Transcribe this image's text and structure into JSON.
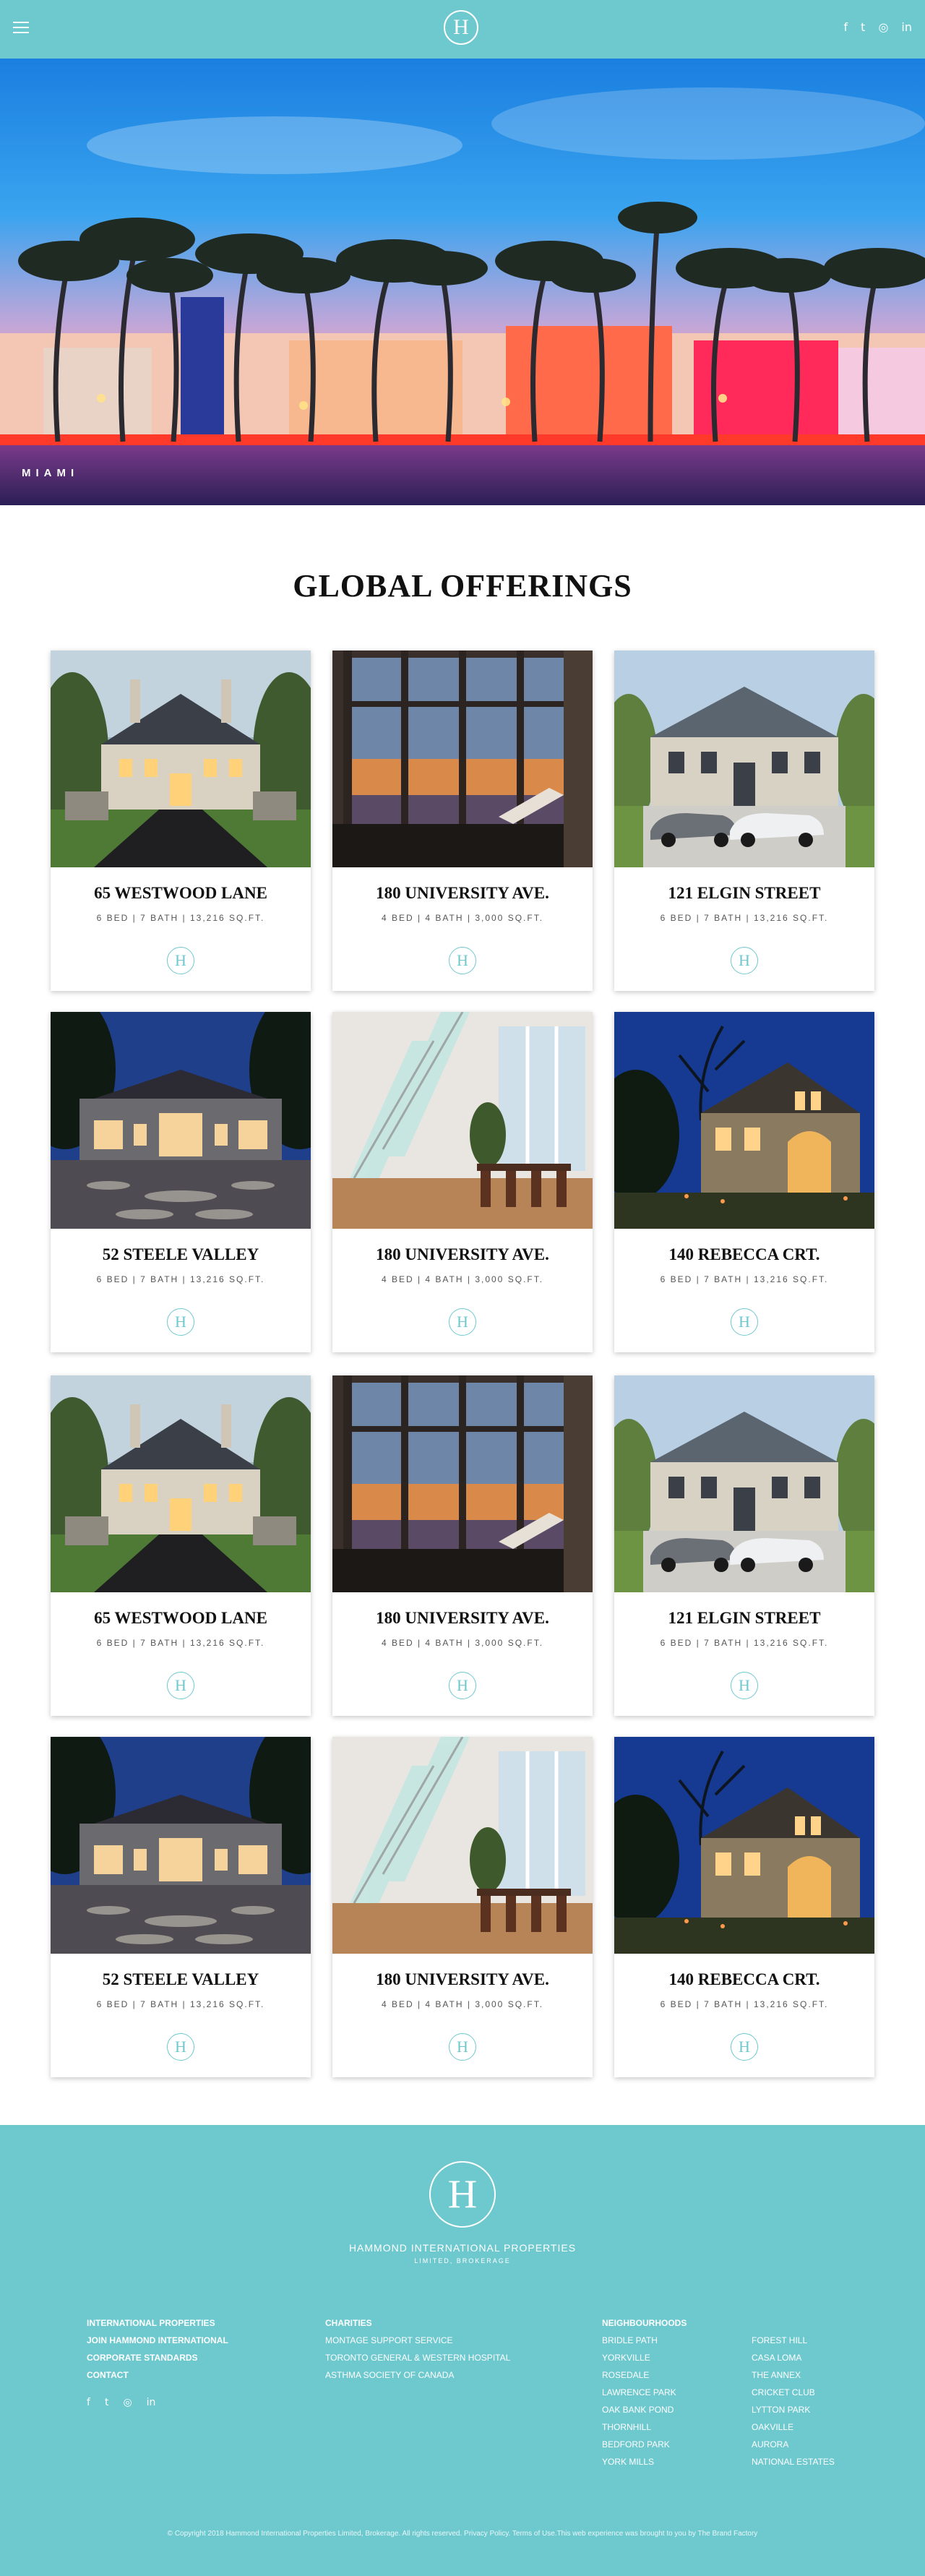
{
  "header": {
    "menu_icon": "hamburger-icon",
    "logo_letter": "H",
    "social": [
      {
        "icon": "facebook-icon",
        "glyph": "f"
      },
      {
        "icon": "twitter-icon",
        "glyph": "t"
      },
      {
        "icon": "instagram-icon",
        "glyph": "◎"
      },
      {
        "icon": "linkedin-icon",
        "glyph": "in"
      }
    ]
  },
  "hero": {
    "label": "MIAMI"
  },
  "section": {
    "title": "GLOBAL OFFERINGS"
  },
  "listings": [
    {
      "name": "65 WESTWOOD LANE",
      "specs": "6 BED  |  7 BATH  |  13,216 SQ.FT.",
      "logo": "H",
      "scene": "mansion-dusk"
    },
    {
      "name": "180 UNIVERSITY AVE.",
      "specs": "4 BED  |  4 BATH  |  3,000 SQ.FT.",
      "logo": "H",
      "scene": "penthouse-window"
    },
    {
      "name": "121 ELGIN STREET",
      "specs": "6 BED  |  7 BATH  |  13,216 SQ.FT.",
      "logo": "H",
      "scene": "estate-cars"
    },
    {
      "name": "52 STEELE VALLEY",
      "specs": "6 BED  |  7 BATH  |  13,216 SQ.FT.",
      "logo": "H",
      "scene": "night-courtyard"
    },
    {
      "name": "180 UNIVERSITY AVE.",
      "specs": "4 BED  |  4 BATH  |  3,000 SQ.FT.",
      "logo": "H",
      "scene": "glass-staircase"
    },
    {
      "name": "140 REBECCA CRT.",
      "specs": "6 BED  |  7 BATH  |  13,216 SQ.FT.",
      "logo": "H",
      "scene": "stone-house-night"
    },
    {
      "name": "65 WESTWOOD LANE",
      "specs": "6 BED  |  7 BATH  |  13,216 SQ.FT.",
      "logo": "H",
      "scene": "mansion-dusk"
    },
    {
      "name": "180 UNIVERSITY AVE.",
      "specs": "4 BED  |  4 BATH  |  3,000 SQ.FT.",
      "logo": "H",
      "scene": "penthouse-window"
    },
    {
      "name": "121 ELGIN STREET",
      "specs": "6 BED  |  7 BATH  |  13,216 SQ.FT.",
      "logo": "H",
      "scene": "estate-cars"
    },
    {
      "name": "52 STEELE VALLEY",
      "specs": "6 BED  |  7 BATH  |  13,216 SQ.FT.",
      "logo": "H",
      "scene": "night-courtyard"
    },
    {
      "name": "180 UNIVERSITY AVE.",
      "specs": "4 BED  |  4 BATH  |  3,000 SQ.FT.",
      "logo": "H",
      "scene": "glass-staircase"
    },
    {
      "name": "140 REBECCA CRT.",
      "specs": "6 BED  |  7 BATH  |  13,216 SQ.FT.",
      "logo": "H",
      "scene": "stone-house-night"
    }
  ],
  "footer": {
    "logo_letter": "H",
    "brand": "HAMMOND INTERNATIONAL PROPERTIES",
    "brand_sub": "LIMITED, BROKERAGE",
    "col1": [
      "INTERNATIONAL PROPERTIES",
      "JOIN HAMMOND INTERNATIONAL",
      "CORPORATE STANDARDS",
      "CONTACT"
    ],
    "charities_head": "CHARITIES",
    "charities": [
      "MONTAGE SUPPORT SERVICE",
      "TORONTO GENERAL & WESTERN HOSPITAL",
      "ASTHMA SOCIETY OF CANADA"
    ],
    "neighbourhoods_head": "NEIGHBOURHOODS",
    "neighbourhoods_a": [
      "BRIDLE PATH",
      "YORKVILLE",
      "ROSEDALE",
      "LAWRENCE PARK",
      "OAK BANK POND",
      "THORNHILL",
      "BEDFORD PARK",
      "YORK MILLS"
    ],
    "neighbourhoods_b": [
      "FOREST HILL",
      "CASA LOMA",
      "THE ANNEX",
      "CRICKET CLUB",
      "LYTTON PARK",
      "OAKVILLE",
      "AURORA",
      "NATIONAL ESTATES"
    ],
    "social": [
      {
        "icon": "facebook-icon",
        "glyph": "f"
      },
      {
        "icon": "twitter-icon",
        "glyph": "t"
      },
      {
        "icon": "instagram-icon",
        "glyph": "◎"
      },
      {
        "icon": "linkedin-icon",
        "glyph": "in"
      }
    ],
    "copyright": "© Copyright 2018 Hammond International Properties Limited, Brokerage. All rights reserved. Privacy Policy. Terms of Use.This web experience was brought to you by The Brand Factory"
  },
  "colors": {
    "teal": "#6ec9cf",
    "white": "#ffffff"
  }
}
